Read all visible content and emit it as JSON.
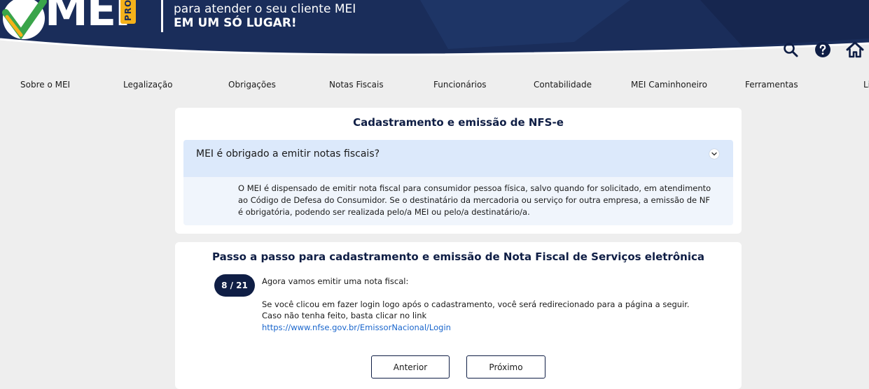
{
  "header": {
    "logo_text": "MEI",
    "logo_badge": "PRO",
    "tagline_line1": "para atender o seu cliente MEI",
    "tagline_line2": "EM UM SÓ LUGAR!",
    "colors": {
      "banner": "#1a2d5a",
      "accent": "#f5b21a"
    }
  },
  "top_icons": [
    {
      "name": "search-icon"
    },
    {
      "name": "help-icon"
    },
    {
      "name": "home-icon"
    }
  ],
  "nav": {
    "items": [
      {
        "label": "Sobre o MEI"
      },
      {
        "label": "Legalização"
      },
      {
        "label": "Obrigações"
      },
      {
        "label": "Notas Fiscais"
      },
      {
        "label": "Funcionários"
      },
      {
        "label": "Contabilidade"
      },
      {
        "label": "MEI Caminhoneiro"
      },
      {
        "label": "Ferramentas"
      },
      {
        "label": "Li"
      }
    ]
  },
  "faq_card": {
    "title": "Cadastramento e emissão de NFS-e",
    "question": "MEI é obrigado a emitir notas fiscais?",
    "answer": "O MEI é dispensado de emitir nota fiscal para consumidor pessoa física, salvo quando for solicitado, em atendimento ao Código de Defesa do Consumidor. Se o destinatário da mercadoria ou serviço for outra empresa, a emissão de NF é obrigatória, podendo ser realizada pelo/a MEI ou pelo/a destinatário/a."
  },
  "steps_card": {
    "title": "Passo a passo para cadastramento e emissão de Nota Fiscal de Serviços eletrônica",
    "step_indicator": "8 / 21",
    "line1": "Agora vamos emitir uma nota fiscal:",
    "line2": "Se você clicou em fazer login logo após o cadastramento, você será redirecionado para a página a seguir. Caso não tenha feito, basta clicar no link",
    "link": "https://www.nfse.gov.br/EmissorNacional/Login",
    "prev_label": "Anterior",
    "next_label": "Próximo"
  }
}
